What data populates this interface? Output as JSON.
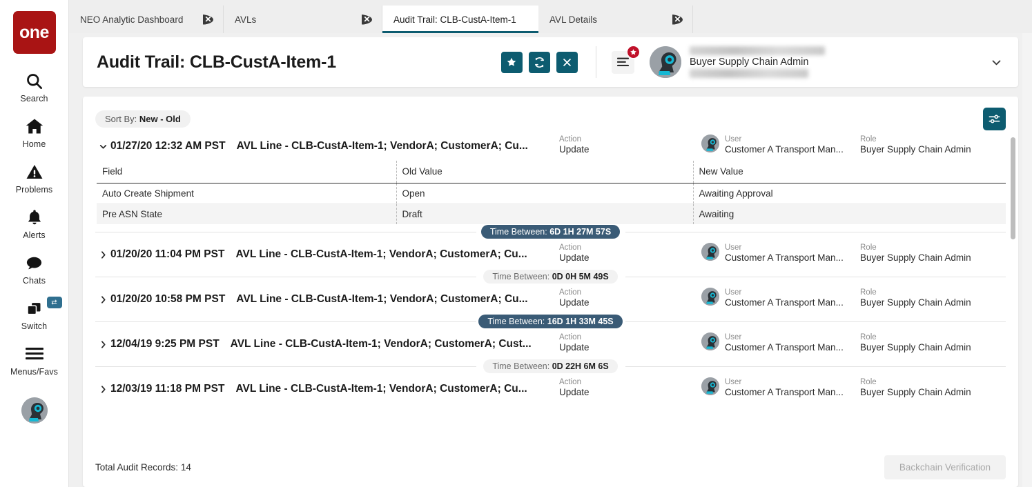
{
  "brand": {
    "logo_text": "one"
  },
  "sidebar": {
    "items": [
      {
        "label": "Search",
        "icon": "search-icon"
      },
      {
        "label": "Home",
        "icon": "home-icon"
      },
      {
        "label": "Problems",
        "icon": "warning-triangle-icon"
      },
      {
        "label": "Alerts",
        "icon": "bell-icon"
      },
      {
        "label": "Chats",
        "icon": "chat-bubble-icon"
      },
      {
        "label": "Switch",
        "icon": "windows-stack-icon",
        "badge_icon": "swap-arrows-icon"
      },
      {
        "label": "Menus/Favs",
        "icon": "hamburger-icon"
      }
    ]
  },
  "tabs": [
    {
      "label": "NEO Analytic Dashboard",
      "active": false
    },
    {
      "label": "AVLs",
      "active": false
    },
    {
      "label": "Audit Trail: CLB-CustA-Item-1",
      "active": true
    },
    {
      "label": "AVL Details",
      "active": false
    }
  ],
  "header": {
    "title": "Audit Trail: CLB-CustA-Item-1",
    "actions": [
      {
        "name": "favorite-button",
        "icon": "star-icon"
      },
      {
        "name": "refresh-button",
        "icon": "refresh-icon"
      },
      {
        "name": "close-button",
        "icon": "close-x-icon"
      }
    ],
    "menu_badge_icon": "star-icon",
    "user_role": "Buyer Supply Chain Admin"
  },
  "toolbar": {
    "sort_prefix": "Sort By: ",
    "sort_value": "New - Old",
    "filter_icon": "sliders-icon"
  },
  "columns": {
    "action": "Action",
    "user": "User",
    "role": "Role"
  },
  "detail_table": {
    "headers": [
      "Field",
      "Old Value",
      "New Value"
    ],
    "rows": [
      [
        "Auto Create Shipment",
        "Open",
        "Awaiting Approval"
      ],
      [
        "Pre ASN State",
        "Draft",
        "Awaiting"
      ]
    ]
  },
  "records": [
    {
      "date": "01/27/20 12:32 AM PST",
      "description": "AVL Line - CLB-CustA-Item-1; VendorA; CustomerA; Cu...",
      "action": "Update",
      "user": "Customer A Transport Man...",
      "role": "Buyer Supply Chain Admin",
      "expanded": true
    },
    {
      "date": "01/20/20 11:04 PM PST",
      "description": "AVL Line - CLB-CustA-Item-1; VendorA; CustomerA; Cu...",
      "action": "Update",
      "user": "Customer A Transport Man...",
      "role": "Buyer Supply Chain Admin",
      "expanded": false
    },
    {
      "date": "01/20/20 10:58 PM PST",
      "description": "AVL Line - CLB-CustA-Item-1; VendorA; CustomerA; Cu...",
      "action": "Update",
      "user": "Customer A Transport Man...",
      "role": "Buyer Supply Chain Admin",
      "expanded": false
    },
    {
      "date": "12/04/19 9:25 PM PST",
      "description": "AVL Line - CLB-CustA-Item-1; VendorA; CustomerA; Cust...",
      "action": "Update",
      "user": "Customer A Transport Man...",
      "role": "Buyer Supply Chain Admin",
      "expanded": false
    },
    {
      "date": "12/03/19 11:18 PM PST",
      "description": "AVL Line - CLB-CustA-Item-1; VendorA; CustomerA; Cu...",
      "action": "Update",
      "user": "Customer A Transport Man...",
      "role": "Buyer Supply Chain Admin",
      "expanded": false
    }
  ],
  "time_between": [
    {
      "prefix": "Time Between: ",
      "value": "6D 1H 27M 57S",
      "style": "dark"
    },
    {
      "prefix": "Time Between: ",
      "value": "0D 0H 5M 49S",
      "style": "light"
    },
    {
      "prefix": "Time Between: ",
      "value": "16D 1H 33M 45S",
      "style": "dark"
    },
    {
      "prefix": "Time Between: ",
      "value": "0D 22H 6M 6S",
      "style": "light"
    }
  ],
  "footer": {
    "total_label": "Total Audit Records: 14",
    "backchain_label": "Backchain Verification"
  },
  "colors": {
    "accent_teal": "#0d5c70",
    "brand_red": "#a91414",
    "badge_dark": "#3a5b76",
    "badge_red": "#c0112a"
  }
}
